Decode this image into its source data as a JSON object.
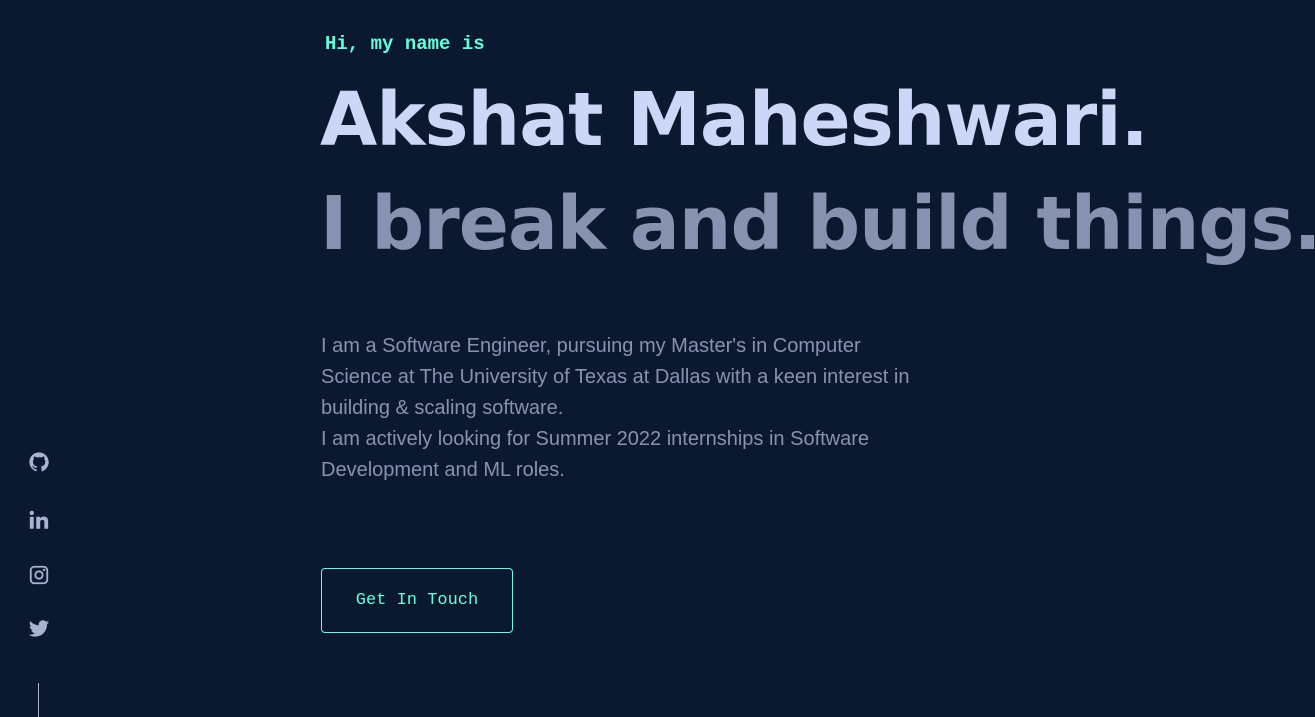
{
  "hero": {
    "intro": "Hi, my name is",
    "name": "Akshat Maheshwari.",
    "tagline": "I break and build things.",
    "bio": [
      "I am a Software Engineer, pursuing my Master's in Computer Science at The University of Texas at Dallas with a keen interest in building & scaling software.",
      "I am actively looking for Summer 2022 internships in Software Development and ML roles."
    ],
    "cta_label": "Get In Touch"
  },
  "social": {
    "items": [
      {
        "icon": "github-icon"
      },
      {
        "icon": "linkedin-icon"
      },
      {
        "icon": "instagram-icon"
      },
      {
        "icon": "twitter-icon"
      }
    ]
  },
  "colors": {
    "background": "#0a192f",
    "accent": "#64ffda",
    "heading": "#ccd6f6",
    "body_text": "#8892b0",
    "icon": "#a8b2d1"
  }
}
